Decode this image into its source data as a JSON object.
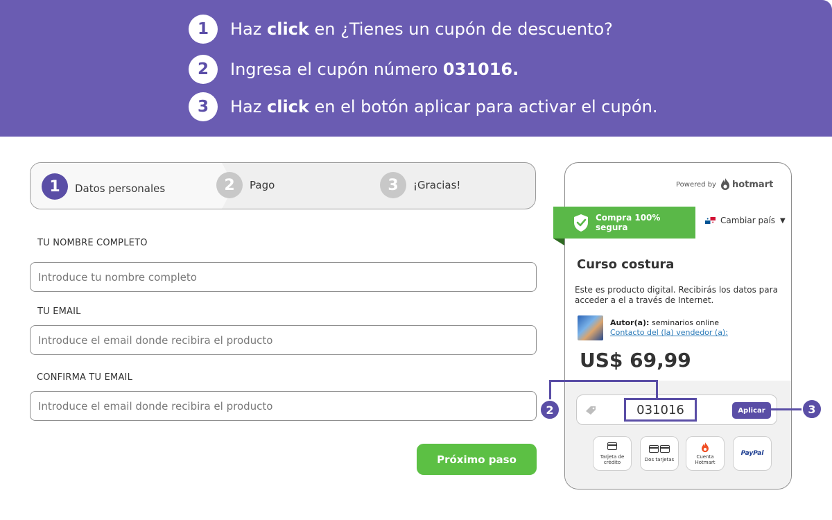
{
  "instructions": [
    {
      "number": "1",
      "prefix": "Haz ",
      "bold": "click",
      "suffix": " en ¿Tienes un cupón de descuento?"
    },
    {
      "number": "2",
      "prefix": "Ingresa el cupón número ",
      "bold": "031016.",
      "suffix": ""
    },
    {
      "number": "3",
      "prefix": "Haz ",
      "bold": "click",
      "suffix": " en el botón aplicar para activar el cupón."
    }
  ],
  "stepper": [
    {
      "number": "1",
      "label": "Datos personales"
    },
    {
      "number": "2",
      "label": "Pago"
    },
    {
      "number": "3",
      "label": "¡Gracias!"
    }
  ],
  "form": {
    "name_label": "TU NOMBRE COMPLETO",
    "name_placeholder": "Introduce tu nombre completo",
    "email_label": "TU EMAIL",
    "email_placeholder": "Introduce el email donde recibira el producto",
    "confirm_label": "CONFIRMA TU EMAIL",
    "confirm_placeholder": "Introduce el email donde recibira el producto",
    "next_button": "Próximo paso"
  },
  "checkout": {
    "powered_by": "Powered by",
    "brand": "hotmart",
    "secure_label": "Compra 100% segura",
    "change_country": "Cambiar país",
    "product_title": "Curso costura",
    "description": "Este es producto digital. Recibirás los datos para acceder a el a través de Internet.",
    "author_label": "Autor(a):",
    "author_name": "seminarios online",
    "contact_link": "Contacto del (la) vendedor (a):",
    "price": "US$ 69,99",
    "coupon_value": "031016",
    "apply_button": "Aplicar",
    "payment_methods": [
      {
        "line1": "Tarjeta de",
        "line2": "crédito"
      },
      {
        "line1": "Dos tarjetas",
        "line2": ""
      },
      {
        "line1": "Cuenta",
        "line2": "Hotmart"
      },
      {
        "line1": "PayPal",
        "line2": ""
      }
    ]
  },
  "callouts": [
    "2",
    "3"
  ],
  "colors": {
    "banner": "#6a5cb2",
    "accent": "#5a4ea6",
    "green": "#5cc044"
  }
}
